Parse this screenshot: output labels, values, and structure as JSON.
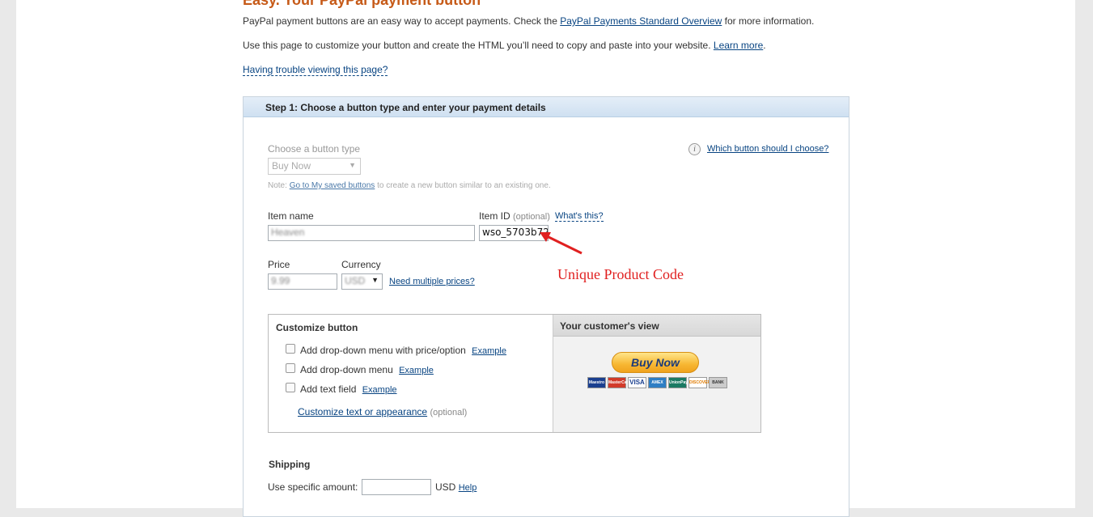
{
  "page": {
    "heading_partial": "Easy. Your PayPal payment button",
    "intro_line1_before": "PayPal payment buttons are an easy way to accept payments. Check the ",
    "intro_line1_link": "PayPal Payments Standard Overview",
    "intro_line1_after": " for more information.",
    "intro_line2_before": "Use this page to customize your button and create the HTML you’ll need to copy and paste into your website. ",
    "intro_line2_link": "Learn more",
    "intro_line2_after": ".",
    "trouble_link": "Having trouble viewing this page?"
  },
  "step1": {
    "header": "Step 1: Choose a button type and enter your payment details",
    "button_type_label": "Choose a button type",
    "button_type_value": "Buy Now",
    "which_button_link": "Which button should I choose?",
    "note_prefix": "Note: ",
    "note_link": "Go to My saved buttons",
    "note_suffix": " to create a new button similar to an existing one.",
    "item_name_label": "Item name",
    "item_name_value": "Heaven",
    "item_id_label": "Item ID",
    "item_id_optional": "(optional)",
    "whats_this_link": "What's this?",
    "item_id_value": "wso_5703b72",
    "price_label": "Price",
    "price_value": "9.99",
    "currency_label": "Currency",
    "currency_value": "USD",
    "multiple_prices_link": "Need multiple prices?"
  },
  "annotation": {
    "text": "Unique Product Code",
    "color": "#e02020"
  },
  "customize": {
    "title": "Customize button",
    "options": [
      {
        "label": "Add drop-down menu with price/option",
        "link": "Example"
      },
      {
        "label": "Add drop-down menu",
        "link": "Example"
      },
      {
        "label": "Add text field",
        "link": "Example"
      }
    ],
    "customize_link": "Customize text or appearance",
    "customize_optional": "(optional)",
    "customer_view_title": "Your customer's view",
    "buy_now_label": "Buy Now",
    "cards": [
      "Maestro",
      "MasterCard",
      "VISA",
      "AMEX",
      "UnionPay",
      "DISCOVER",
      "BANK"
    ]
  },
  "shipping": {
    "title": "Shipping",
    "amount_label": "Use specific amount:",
    "amount_value": "",
    "currency": "USD",
    "help_link": "Help"
  },
  "colors": {
    "link": "#084482",
    "header_bg": "#cfe0f1",
    "heading": "#c65a18"
  }
}
